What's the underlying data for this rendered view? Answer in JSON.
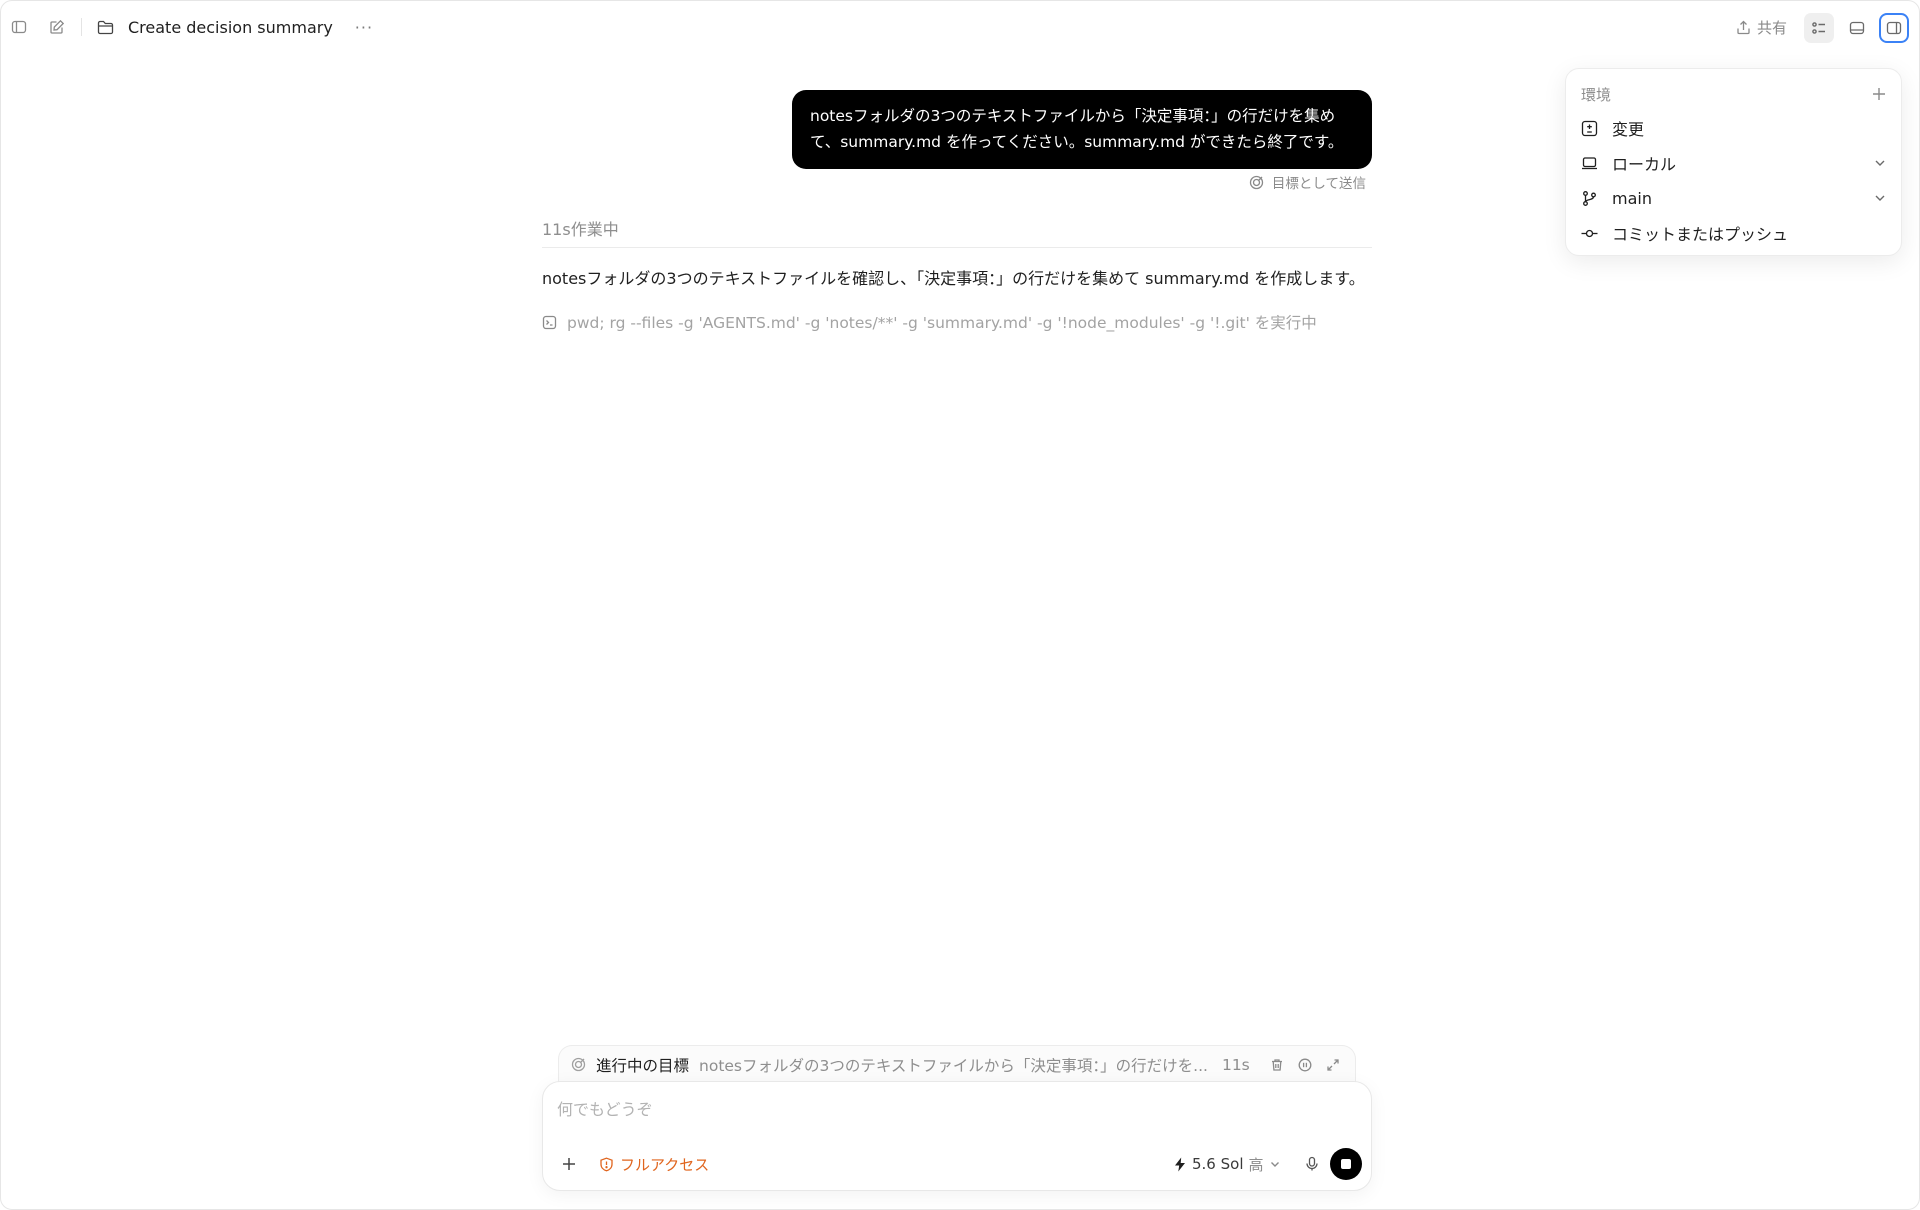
{
  "titlebar": {
    "title": "Create decision summary",
    "more": "···",
    "share_label": "共有"
  },
  "conversation": {
    "user_message": "notesフォルダの3つのテキストファイルから「決定事項：」の行だけを集めて、summary.md を作ってください。summary.md ができたら終了です。",
    "send_as_goal": "目標として送信",
    "working_status": "11s作業中",
    "assistant_message": "notesフォルダの3つのテキストファイルを確認し、「決定事項：」の行だけを集めて summary.md を作成します。",
    "command": "pwd; rg --files -g 'AGENTS.md' -g 'notes/**' -g 'summary.md' -g '!node_modules' -g '!.git' を実行中"
  },
  "environment_panel": {
    "header": "環境",
    "items": [
      {
        "label": "変更",
        "icon": "diff-icon"
      },
      {
        "label": "ローカル",
        "icon": "laptop-icon"
      },
      {
        "label": "main",
        "icon": "branch-icon"
      },
      {
        "label": "コミットまたはプッシュ",
        "icon": "commit-icon"
      }
    ]
  },
  "goal_strip": {
    "label": "進行中の目標",
    "text": "notesフォルダの3つのテキストファイルから「決定事項：」の行だけを...",
    "time": "11s"
  },
  "composer": {
    "placeholder": "何でもどうぞ",
    "access_label": "フルアクセス",
    "model_label": "5.6 Sol",
    "effort_label": "高"
  },
  "colors": {
    "accent_blue": "#3b82f6",
    "access_orange": "#e0651e",
    "bubble_bg": "#000000"
  }
}
